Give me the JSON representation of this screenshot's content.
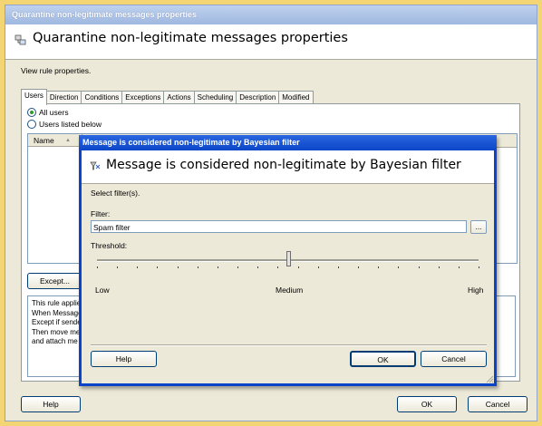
{
  "outer": {
    "window_title": "Quarantine non-legitimate messages properties",
    "header_title": "Quarantine non-legitimate messages properties",
    "subtitle": "View rule properties.",
    "tabs": [
      {
        "label": "Users",
        "active": true
      },
      {
        "label": "Direction"
      },
      {
        "label": "Conditions"
      },
      {
        "label": "Exceptions"
      },
      {
        "label": "Actions"
      },
      {
        "label": "Scheduling"
      },
      {
        "label": "Description"
      },
      {
        "label": "Modified"
      }
    ],
    "radio_all_users": "All users",
    "radio_listed_users": "Users listed below",
    "list_column_name": "Name",
    "except_button": "Except...",
    "description_lines": [
      "This rule applie",
      "When Message",
      "Except if sende",
      "Then move me",
      "and attach me"
    ],
    "help_button": "Help",
    "ok_button": "OK",
    "cancel_button": "Cancel"
  },
  "modal": {
    "window_title": "Message is considered non-legitimate by Bayesian filter",
    "header_title": "Message is considered non-legitimate by Bayesian filter",
    "select_label": "Select filter(s).",
    "filter_label": "Filter:",
    "filter_value": "Spam filter",
    "browse_button": "...",
    "threshold_label": "Threshold:",
    "threshold_value_fraction": 0.5,
    "tick_count": 20,
    "low_label": "Low",
    "medium_label": "Medium",
    "high_label": "High",
    "help_button": "Help",
    "ok_button": "OK",
    "cancel_button": "Cancel"
  },
  "colors": {
    "desktop": "#f3d673",
    "modal_titlebar": "#0a46c8",
    "dialog_face": "#ece9d8"
  }
}
